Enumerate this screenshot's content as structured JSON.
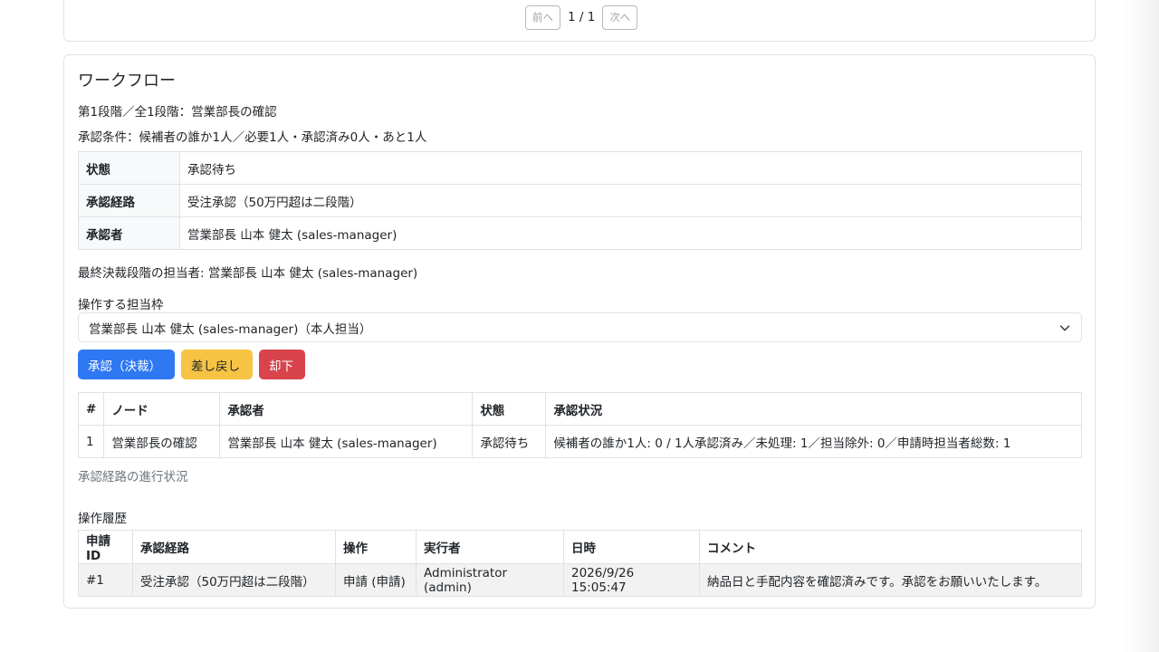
{
  "pager": {
    "prev": "前へ",
    "page": "1 / 1",
    "next": "次へ"
  },
  "workflow": {
    "title": "ワークフロー",
    "stage": "第1段階／全1段階：営業部長の確認",
    "condition": "承認条件：候補者の誰か1人／必要1人・承認済み0人・あと1人",
    "info": [
      {
        "label": "状態",
        "value": "承認待ち"
      },
      {
        "label": "承認経路",
        "value": "受注承認（50万円超は二段階）"
      },
      {
        "label": "承認者",
        "value": "営業部長 山本 健太 (sales-manager)"
      }
    ],
    "final_assignee": "最終決裁段階の担当者: 営業部長 山本 健太 (sales-manager)",
    "select_label": "操作する担当枠",
    "select_value": "営業部長 山本 健太 (sales-manager)（本人担当）",
    "buttons": {
      "approve": "承認（決裁）",
      "return": "差し戻し",
      "reject": "却下"
    },
    "nodes": {
      "headers": [
        "#",
        "ノード",
        "承認者",
        "状態",
        "承認状況"
      ],
      "rows": [
        [
          "1",
          "営業部長の確認",
          "営業部長 山本 健太 (sales-manager)",
          "承認待ち",
          "候補者の誰か1人: 0 / 1人承認済み／未処理: 1／担当除外: 0／申請時担当者総数: 1"
        ]
      ],
      "caption": "承認経路の進行状況"
    },
    "history": {
      "label": "操作履歴",
      "headers": [
        "申請ID",
        "承認経路",
        "操作",
        "実行者",
        "日時",
        "コメント"
      ],
      "rows": [
        [
          "#1",
          "受注承認（50万円超は二段階）",
          "申請 (申請)",
          "Administrator (admin)",
          "2026/9/26 15:05:47",
          "納品日と手配内容を確認済みです。承認をお願いいたします。"
        ]
      ]
    }
  },
  "colors": {
    "primary": "#2f78f3",
    "warning": "#f6c343",
    "danger": "#d9444c"
  }
}
